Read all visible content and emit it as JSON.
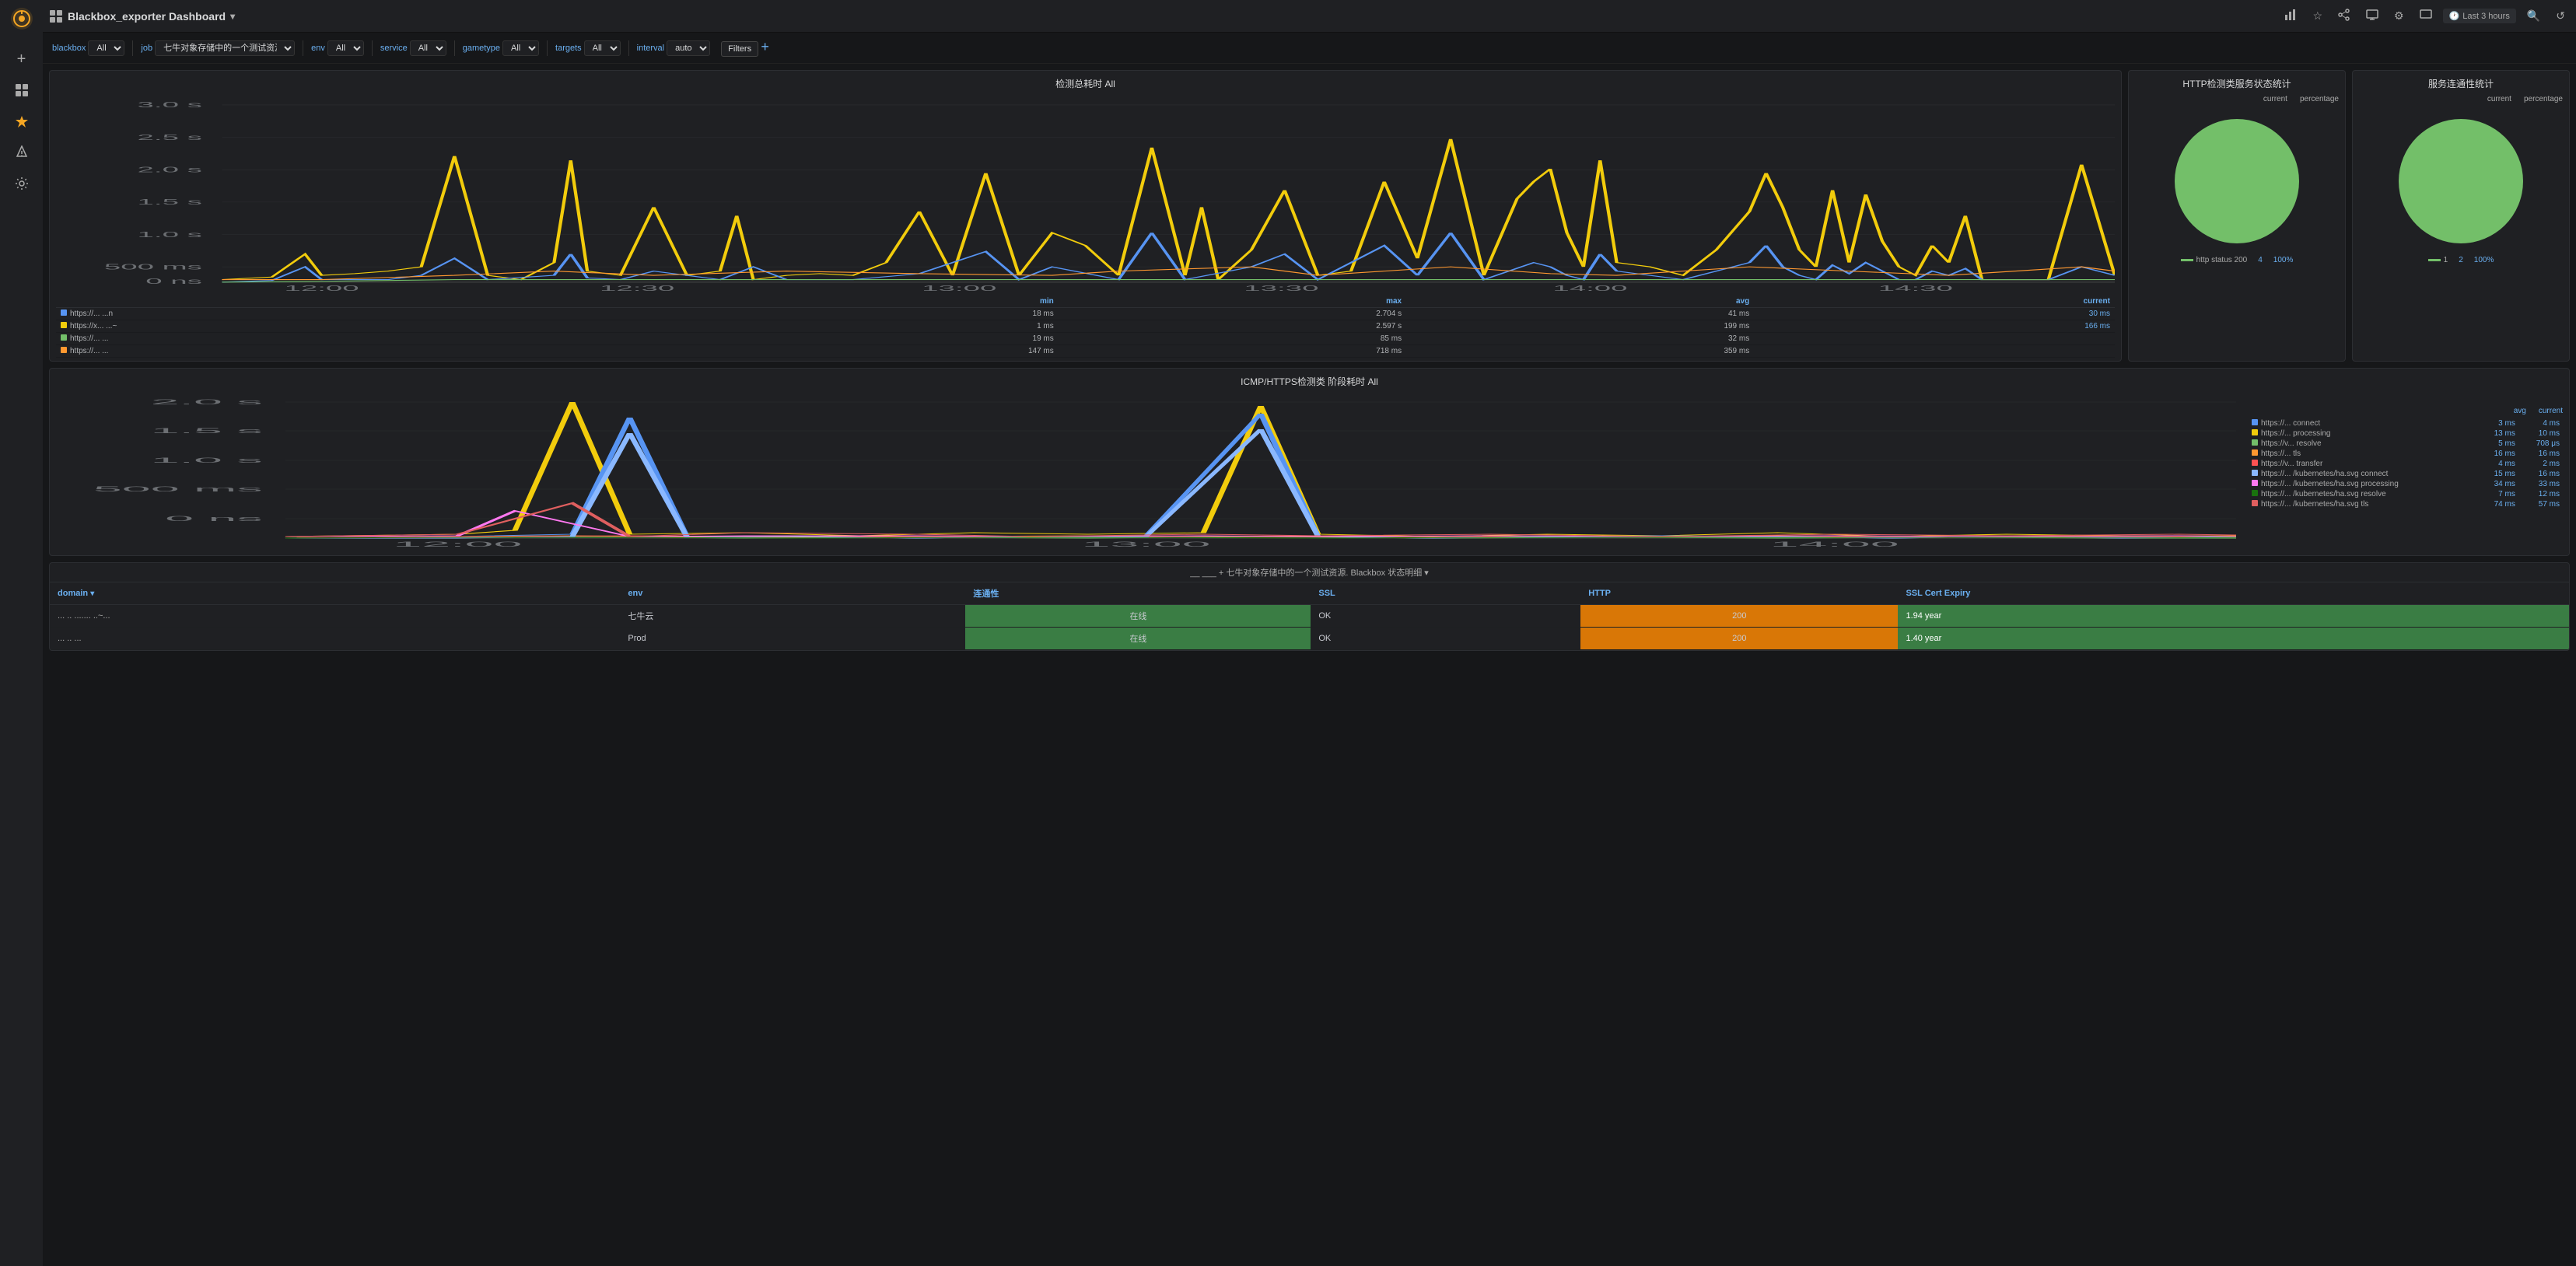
{
  "sidebar": {
    "logo": "grafana",
    "items": [
      {
        "id": "add",
        "icon": "+",
        "label": "add"
      },
      {
        "id": "grid",
        "icon": "⊞",
        "label": "dashboards"
      },
      {
        "id": "star",
        "icon": "★",
        "label": "starred"
      },
      {
        "id": "bell",
        "icon": "🔔",
        "label": "alerts"
      },
      {
        "id": "gear",
        "icon": "⚙",
        "label": "settings"
      }
    ]
  },
  "topbar": {
    "title": "Blackbox_exporter Dashboard",
    "icons": [
      "chart",
      "star",
      "share",
      "tv",
      "settings",
      "monitor"
    ],
    "time_range": "Last 3 hours",
    "search_placeholder": "Search"
  },
  "filterbar": {
    "filters": [
      {
        "label": "blackbox",
        "value": "All",
        "options": [
          "All"
        ]
      },
      {
        "label": "job",
        "value": "七牛对象存储中的一个测试资源...",
        "options": []
      },
      {
        "label": "env",
        "value": "All",
        "options": [
          "All"
        ]
      },
      {
        "label": "service",
        "value": "All",
        "options": [
          "All"
        ]
      },
      {
        "label": "gametype",
        "value": "All",
        "options": [
          "All"
        ]
      },
      {
        "label": "targets",
        "value": "All",
        "options": [
          "All"
        ]
      },
      {
        "label": "interval",
        "value": "auto",
        "options": [
          "auto"
        ]
      }
    ],
    "filters_btn": "Filters",
    "add_btn": "+"
  },
  "panel1": {
    "title": "检测总耗时 All",
    "y_labels": [
      "3.0 s",
      "2.5 s",
      "2.0 s",
      "1.5 s",
      "1.0 s",
      "500 ms",
      "0 ns"
    ],
    "x_labels": [
      "12:00",
      "12:30",
      "13:00",
      "13:30",
      "14:00",
      "14:30"
    ],
    "legend_headers": [
      "min",
      "max",
      "avg",
      "current"
    ],
    "legend_rows": [
      {
        "color": "#5794f2",
        "label": "https://... ...n",
        "min": "18 ms",
        "max": "2.704 s",
        "avg": "41 ms",
        "current": "30 ms"
      },
      {
        "color": "#f2cc0c",
        "label": "https://x... ...~",
        "min": "1 ms",
        "max": "2.597 s",
        "avg": "199 ms",
        "current": "166 ms"
      },
      {
        "color": "#73bf69",
        "label": "https://... ...",
        "min": "19 ms",
        "max": "85 ms",
        "avg": "32 ms",
        "current": ""
      },
      {
        "color": "#ff9830",
        "label": "https://... ...",
        "min": "147 ms",
        "max": "718 ms",
        "avg": "359 ms",
        "current": ""
      }
    ]
  },
  "panel2": {
    "title": "HTTP检测类服务状态统计",
    "legend_header1": "current",
    "legend_header2": "percentage",
    "legend_rows": [
      {
        "color": "#73bf69",
        "label": "http status 200",
        "current": "4",
        "percentage": "100%"
      }
    ]
  },
  "panel3": {
    "title": "服务连通性统计",
    "legend_header1": "current",
    "legend_header2": "percentage",
    "legend_rows": [
      {
        "color": "#73bf69",
        "label": "1",
        "current": "2",
        "percentage": "100%"
      }
    ]
  },
  "panel4": {
    "title": "ICMP/HTTPS检测类 阶段耗时 All",
    "y_labels": [
      "2.0 s",
      "1.5 s",
      "1.0 s",
      "500 ms",
      "0 ns"
    ],
    "x_labels": [
      "12:00",
      "13:00",
      "14:00"
    ],
    "legend_headers": [
      "avg",
      "current"
    ],
    "legend_rows": [
      {
        "color": "#5794f2",
        "label": "https://... connect",
        "avg": "3 ms",
        "current": "4 ms"
      },
      {
        "color": "#f2cc0c",
        "label": "https://... processing",
        "avg": "13 ms",
        "current": "10 ms"
      },
      {
        "color": "#73bf69",
        "label": "https://v... resolve",
        "avg": "5 ms",
        "current": "708 μs"
      },
      {
        "color": "#ff9830",
        "label": "https://... tls",
        "avg": "16 ms",
        "current": "16 ms"
      },
      {
        "color": "#f43b3b",
        "label": "https://v... transfer",
        "avg": "4 ms",
        "current": "2 ms"
      },
      {
        "color": "#8ab8ff",
        "label": "https://... /kubernetes/ha.svg connect",
        "avg": "15 ms",
        "current": "16 ms"
      },
      {
        "color": "#ff78f0",
        "label": "https://... /kubernetes/ha.svg processing",
        "avg": "34 ms",
        "current": "33 ms"
      },
      {
        "color": "#19730e",
        "label": "https://... /kubernetes/ha.svg resolve",
        "avg": "7 ms",
        "current": "12 ms"
      },
      {
        "color": "#e05f5f",
        "label": "https://... /kubernetes/ha.svg tls",
        "avg": "74 ms",
        "current": "57 ms"
      }
    ]
  },
  "panel5": {
    "subtitle": "__ ___ + 七牛对象存储中的一个测试资源. Blackbox 状态明细 ▾",
    "table_headers": [
      "domain",
      "env",
      "连通性",
      "SSL",
      "HTTP",
      "SSL Cert Expiry"
    ],
    "rows": [
      {
        "domain": "... .. ....... ..~...",
        "env": "七牛云",
        "connectivity": "在线",
        "ssl": "OK",
        "http": "200",
        "expiry": "1.94 year"
      },
      {
        "domain": "... .. ...",
        "env": "Prod",
        "connectivity": "在线",
        "ssl": "OK",
        "http": "200",
        "expiry": "1.40 year"
      }
    ]
  }
}
